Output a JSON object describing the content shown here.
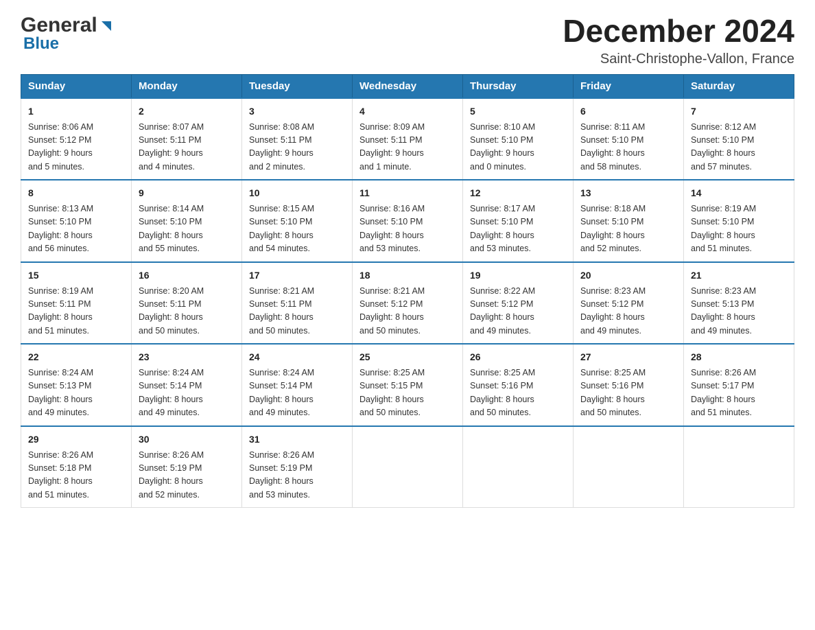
{
  "header": {
    "logo_general": "General",
    "logo_blue": "Blue",
    "title": "December 2024",
    "location": "Saint-Christophe-Vallon, France"
  },
  "columns": [
    "Sunday",
    "Monday",
    "Tuesday",
    "Wednesday",
    "Thursday",
    "Friday",
    "Saturday"
  ],
  "weeks": [
    [
      {
        "day": "1",
        "sunrise": "Sunrise: 8:06 AM",
        "sunset": "Sunset: 5:12 PM",
        "daylight": "Daylight: 9 hours",
        "extra": "and 5 minutes."
      },
      {
        "day": "2",
        "sunrise": "Sunrise: 8:07 AM",
        "sunset": "Sunset: 5:11 PM",
        "daylight": "Daylight: 9 hours",
        "extra": "and 4 minutes."
      },
      {
        "day": "3",
        "sunrise": "Sunrise: 8:08 AM",
        "sunset": "Sunset: 5:11 PM",
        "daylight": "Daylight: 9 hours",
        "extra": "and 2 minutes."
      },
      {
        "day": "4",
        "sunrise": "Sunrise: 8:09 AM",
        "sunset": "Sunset: 5:11 PM",
        "daylight": "Daylight: 9 hours",
        "extra": "and 1 minute."
      },
      {
        "day": "5",
        "sunrise": "Sunrise: 8:10 AM",
        "sunset": "Sunset: 5:10 PM",
        "daylight": "Daylight: 9 hours",
        "extra": "and 0 minutes."
      },
      {
        "day": "6",
        "sunrise": "Sunrise: 8:11 AM",
        "sunset": "Sunset: 5:10 PM",
        "daylight": "Daylight: 8 hours",
        "extra": "and 58 minutes."
      },
      {
        "day": "7",
        "sunrise": "Sunrise: 8:12 AM",
        "sunset": "Sunset: 5:10 PM",
        "daylight": "Daylight: 8 hours",
        "extra": "and 57 minutes."
      }
    ],
    [
      {
        "day": "8",
        "sunrise": "Sunrise: 8:13 AM",
        "sunset": "Sunset: 5:10 PM",
        "daylight": "Daylight: 8 hours",
        "extra": "and 56 minutes."
      },
      {
        "day": "9",
        "sunrise": "Sunrise: 8:14 AM",
        "sunset": "Sunset: 5:10 PM",
        "daylight": "Daylight: 8 hours",
        "extra": "and 55 minutes."
      },
      {
        "day": "10",
        "sunrise": "Sunrise: 8:15 AM",
        "sunset": "Sunset: 5:10 PM",
        "daylight": "Daylight: 8 hours",
        "extra": "and 54 minutes."
      },
      {
        "day": "11",
        "sunrise": "Sunrise: 8:16 AM",
        "sunset": "Sunset: 5:10 PM",
        "daylight": "Daylight: 8 hours",
        "extra": "and 53 minutes."
      },
      {
        "day": "12",
        "sunrise": "Sunrise: 8:17 AM",
        "sunset": "Sunset: 5:10 PM",
        "daylight": "Daylight: 8 hours",
        "extra": "and 53 minutes."
      },
      {
        "day": "13",
        "sunrise": "Sunrise: 8:18 AM",
        "sunset": "Sunset: 5:10 PM",
        "daylight": "Daylight: 8 hours",
        "extra": "and 52 minutes."
      },
      {
        "day": "14",
        "sunrise": "Sunrise: 8:19 AM",
        "sunset": "Sunset: 5:10 PM",
        "daylight": "Daylight: 8 hours",
        "extra": "and 51 minutes."
      }
    ],
    [
      {
        "day": "15",
        "sunrise": "Sunrise: 8:19 AM",
        "sunset": "Sunset: 5:11 PM",
        "daylight": "Daylight: 8 hours",
        "extra": "and 51 minutes."
      },
      {
        "day": "16",
        "sunrise": "Sunrise: 8:20 AM",
        "sunset": "Sunset: 5:11 PM",
        "daylight": "Daylight: 8 hours",
        "extra": "and 50 minutes."
      },
      {
        "day": "17",
        "sunrise": "Sunrise: 8:21 AM",
        "sunset": "Sunset: 5:11 PM",
        "daylight": "Daylight: 8 hours",
        "extra": "and 50 minutes."
      },
      {
        "day": "18",
        "sunrise": "Sunrise: 8:21 AM",
        "sunset": "Sunset: 5:12 PM",
        "daylight": "Daylight: 8 hours",
        "extra": "and 50 minutes."
      },
      {
        "day": "19",
        "sunrise": "Sunrise: 8:22 AM",
        "sunset": "Sunset: 5:12 PM",
        "daylight": "Daylight: 8 hours",
        "extra": "and 49 minutes."
      },
      {
        "day": "20",
        "sunrise": "Sunrise: 8:23 AM",
        "sunset": "Sunset: 5:12 PM",
        "daylight": "Daylight: 8 hours",
        "extra": "and 49 minutes."
      },
      {
        "day": "21",
        "sunrise": "Sunrise: 8:23 AM",
        "sunset": "Sunset: 5:13 PM",
        "daylight": "Daylight: 8 hours",
        "extra": "and 49 minutes."
      }
    ],
    [
      {
        "day": "22",
        "sunrise": "Sunrise: 8:24 AM",
        "sunset": "Sunset: 5:13 PM",
        "daylight": "Daylight: 8 hours",
        "extra": "and 49 minutes."
      },
      {
        "day": "23",
        "sunrise": "Sunrise: 8:24 AM",
        "sunset": "Sunset: 5:14 PM",
        "daylight": "Daylight: 8 hours",
        "extra": "and 49 minutes."
      },
      {
        "day": "24",
        "sunrise": "Sunrise: 8:24 AM",
        "sunset": "Sunset: 5:14 PM",
        "daylight": "Daylight: 8 hours",
        "extra": "and 49 minutes."
      },
      {
        "day": "25",
        "sunrise": "Sunrise: 8:25 AM",
        "sunset": "Sunset: 5:15 PM",
        "daylight": "Daylight: 8 hours",
        "extra": "and 50 minutes."
      },
      {
        "day": "26",
        "sunrise": "Sunrise: 8:25 AM",
        "sunset": "Sunset: 5:16 PM",
        "daylight": "Daylight: 8 hours",
        "extra": "and 50 minutes."
      },
      {
        "day": "27",
        "sunrise": "Sunrise: 8:25 AM",
        "sunset": "Sunset: 5:16 PM",
        "daylight": "Daylight: 8 hours",
        "extra": "and 50 minutes."
      },
      {
        "day": "28",
        "sunrise": "Sunrise: 8:26 AM",
        "sunset": "Sunset: 5:17 PM",
        "daylight": "Daylight: 8 hours",
        "extra": "and 51 minutes."
      }
    ],
    [
      {
        "day": "29",
        "sunrise": "Sunrise: 8:26 AM",
        "sunset": "Sunset: 5:18 PM",
        "daylight": "Daylight: 8 hours",
        "extra": "and 51 minutes."
      },
      {
        "day": "30",
        "sunrise": "Sunrise: 8:26 AM",
        "sunset": "Sunset: 5:19 PM",
        "daylight": "Daylight: 8 hours",
        "extra": "and 52 minutes."
      },
      {
        "day": "31",
        "sunrise": "Sunrise: 8:26 AM",
        "sunset": "Sunset: 5:19 PM",
        "daylight": "Daylight: 8 hours",
        "extra": "and 53 minutes."
      },
      null,
      null,
      null,
      null
    ]
  ]
}
